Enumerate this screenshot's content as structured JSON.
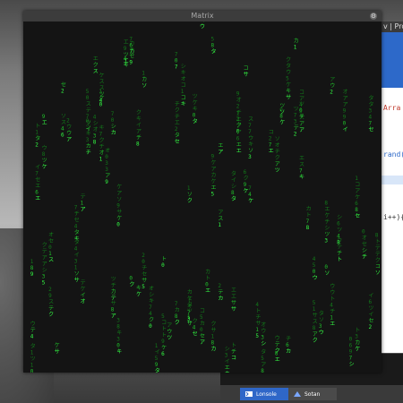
{
  "window": {
    "title": "Matrix",
    "close_glyph": "⚙"
  },
  "editor": {
    "title": "v | Pro",
    "code_lines": [
      {
        "text": "Arra",
        "color": "#c0392b"
      },
      {
        "text": "rand(",
        "color": "#2d69c9"
      },
      {
        "text": "i++){",
        "color": "#333333"
      }
    ]
  },
  "taskbar": {
    "items": [
      {
        "label": "Lonsole",
        "icon": "terminal-icon"
      },
      {
        "label": "Sotan",
        "icon": "warning-icon"
      }
    ]
  },
  "colors": {
    "matrix_bright": "#33ff44",
    "matrix_mid": "#1fbf2a",
    "matrix_dim": "#127a1a",
    "window_bg": "#141414",
    "accent_blue": "#2f67c8"
  }
}
